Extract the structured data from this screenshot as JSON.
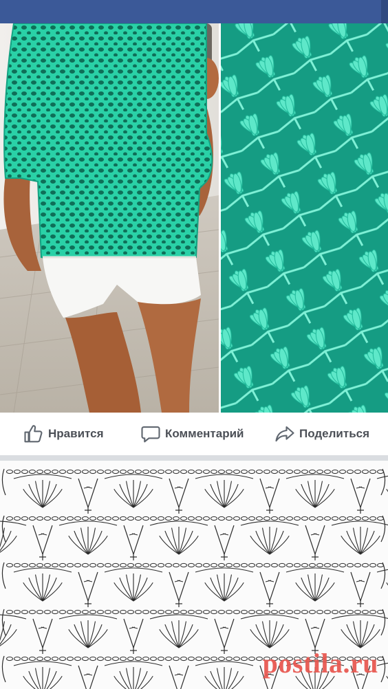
{
  "app": {
    "brand_color": "#3b5998"
  },
  "post": {
    "photo_left": "turquoise-crochet-top-photo",
    "photo_right": "crochet-stitch-closeup-photo",
    "thread_color": "#3fd9b3"
  },
  "actions": {
    "like": {
      "label": "Нравится",
      "icon": "thumbs-up-icon"
    },
    "comment": {
      "label": "Комментарий",
      "icon": "speech-bubble-icon"
    },
    "share": {
      "label": "Поделиться",
      "icon": "share-arrow-icon"
    }
  },
  "pattern_chart": {
    "image": "crochet-pattern-diagram",
    "watermark": "postila.ru"
  }
}
